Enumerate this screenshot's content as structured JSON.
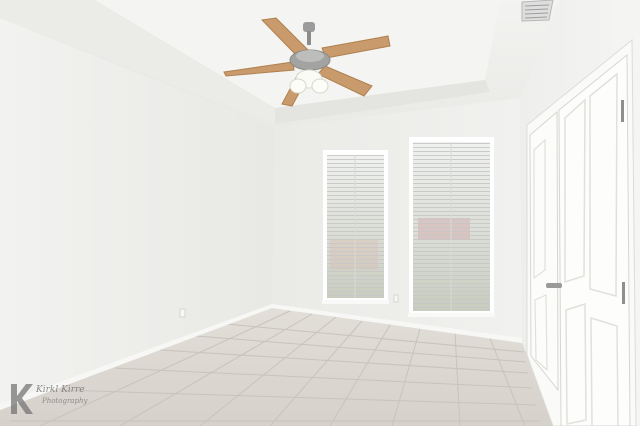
{
  "photo": {
    "subject": "empty-bedroom",
    "features": [
      "tray-ceiling",
      "ceiling-fan-with-light",
      "two-windows-with-blinds",
      "double-closet-doors",
      "tile-floor",
      "air-vent"
    ]
  },
  "colors": {
    "wall": "#eeeeec",
    "ceiling": "#f2f2f0",
    "floor": "#dcd8d2",
    "fan_blade": "#c99a6b",
    "blind": "#f4f4f2",
    "window_frame": "#ffffff"
  },
  "watermark": {
    "brand": "Kirkl Kirre",
    "sub": "Photography"
  }
}
